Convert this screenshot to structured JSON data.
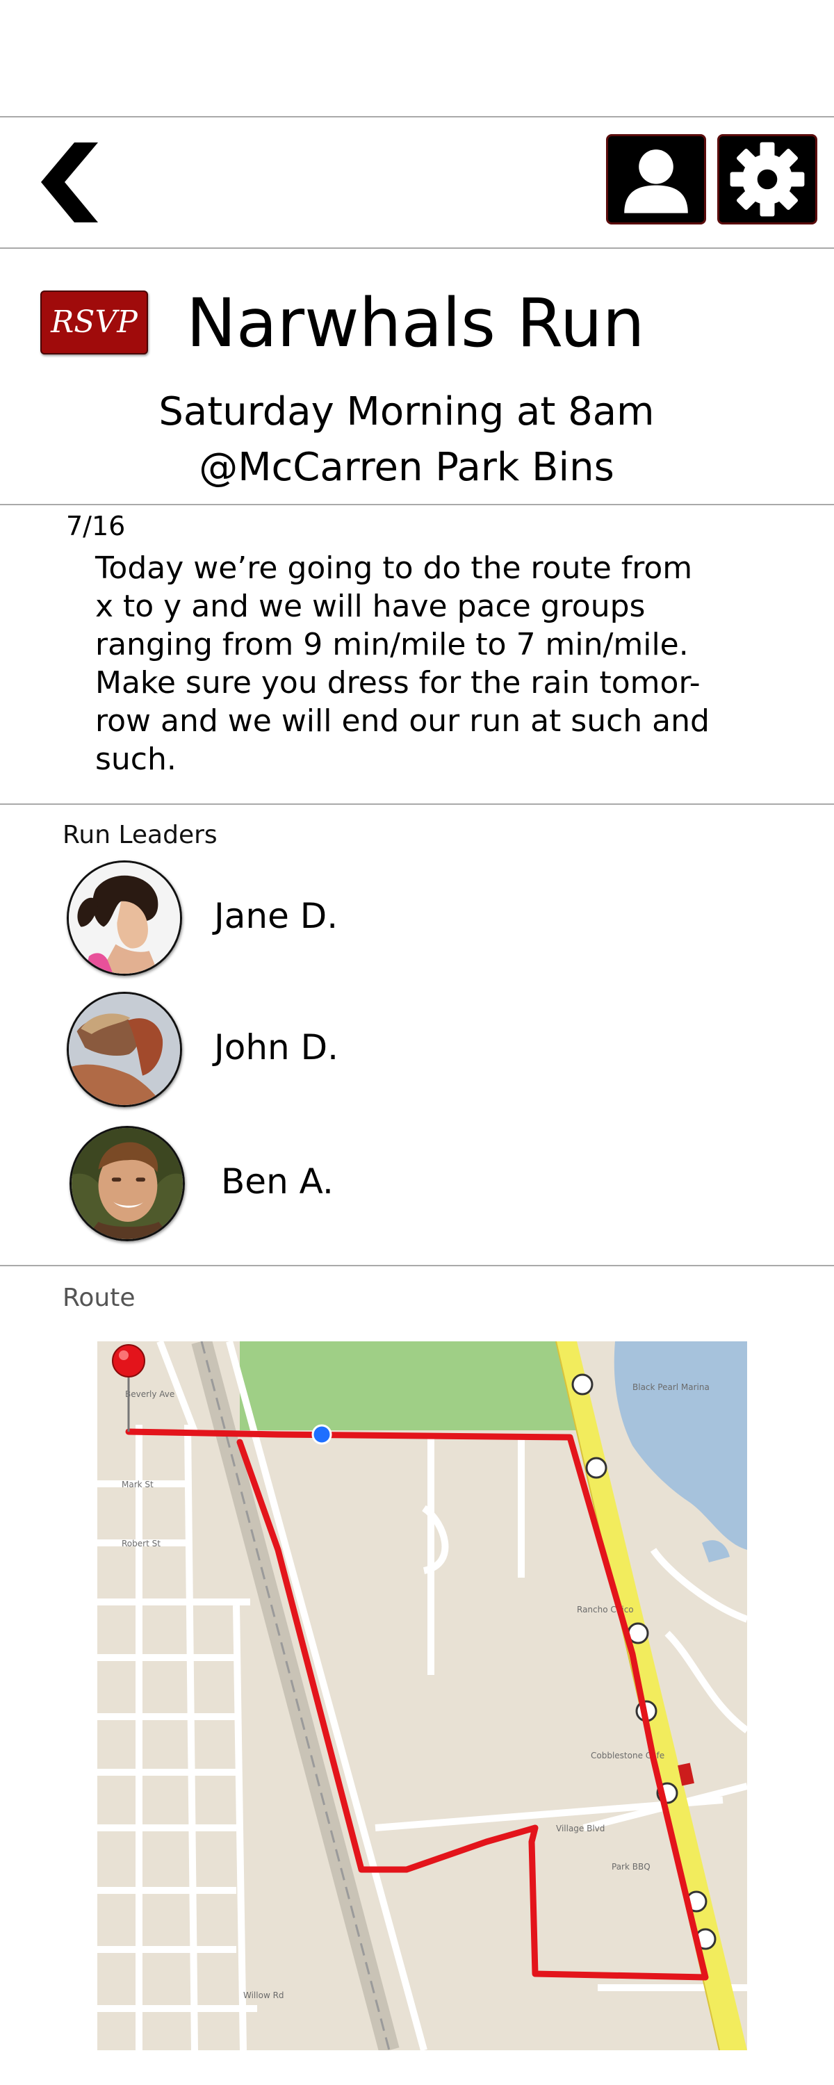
{
  "header": {
    "back_icon": "chevron-left-icon",
    "profile_icon": "user-icon",
    "settings_icon": "gear-icon"
  },
  "event": {
    "rsvp_label": "RSVP",
    "title": "Narwhals Run",
    "schedule": "Saturday Morning at 8am",
    "location": "@McCarren Park Bins"
  },
  "post": {
    "date": "7/16",
    "lines": [
      "Today we’re going to do the route from",
      "x to y and we will have pace groups",
      "ranging from 9 min/mile to 7 min/mile.",
      "Make sure you dress for the rain tomor-",
      "row and we will end our run at such and",
      "such."
    ]
  },
  "leaders": {
    "heading": "Run Leaders",
    "items": [
      {
        "name": "Jane D."
      },
      {
        "name": "John D."
      },
      {
        "name": "Ben A."
      }
    ]
  },
  "route": {
    "heading": "Route"
  },
  "colors": {
    "rsvp": "#a00b0b",
    "route_line": "#e3141b",
    "divider": "#a9a9a9",
    "map_park": "#9fcf86",
    "map_water": "#a6c2dc",
    "map_highway": "#f2ec5d"
  }
}
